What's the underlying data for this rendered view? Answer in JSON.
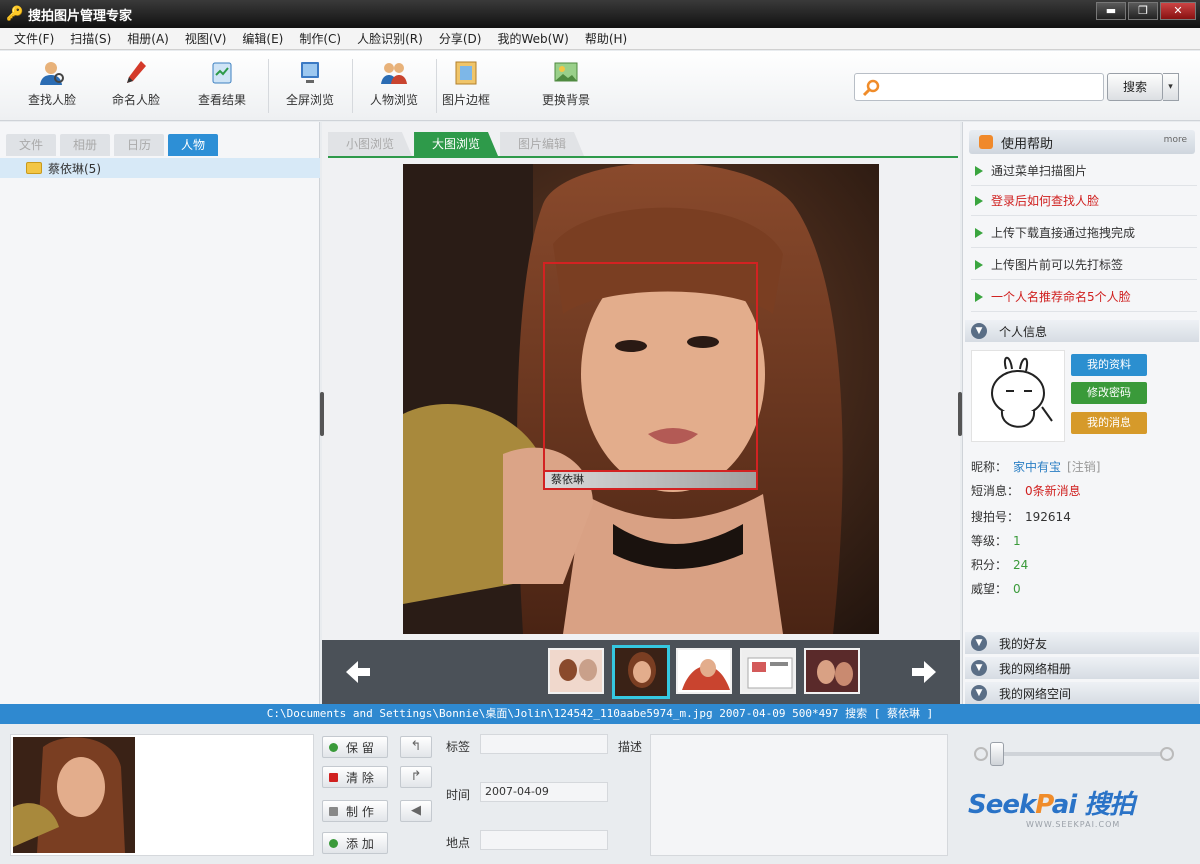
{
  "window": {
    "title": "搜拍图片管理专家",
    "controls": {
      "minimize": "▬",
      "restore": "❐",
      "close": "✕"
    }
  },
  "menu": [
    "文件(F)",
    "扫描(S)",
    "相册(A)",
    "视图(V)",
    "编辑(E)",
    "制作(C)",
    "人脸识别(R)",
    "分享(D)",
    "我的Web(W)",
    "帮助(H)"
  ],
  "toolbar": {
    "find_face": "查找人脸",
    "name_face": "命名人脸",
    "view_results": "查看结果",
    "fullscreen": "全屏浏览",
    "people_browse": "人物浏览",
    "photo_frame": "图片边框",
    "change_bg": "更换背景"
  },
  "search": {
    "placeholder": "",
    "button": "搜索",
    "dropdown": "▾"
  },
  "left_tabs": [
    "文件",
    "相册",
    "日历",
    "人物"
  ],
  "left_tabs_active": 3,
  "tree": {
    "item": "蔡依琳(5)"
  },
  "center_tabs": [
    "小图浏览",
    "大图浏览",
    "图片编辑"
  ],
  "center_tabs_active": 1,
  "face_tag": "蔡依琳",
  "status_path": "C:\\Documents and Settings\\Bonnie\\桌面\\Jolin\\124542_110aabe5974_m.jpg 2007-04-09 500*497 搜索 [ 蔡依琳 ]",
  "help": {
    "title": "使用帮助",
    "more": "more",
    "items": [
      {
        "text": "通过菜单扫描图片",
        "color": "#333333"
      },
      {
        "text": "登录后如何查找人脸",
        "color": "#d0201f"
      },
      {
        "text": "上传下载直接通过拖拽完成",
        "color": "#333333"
      },
      {
        "text": "上传图片前可以先打标签",
        "color": "#333333"
      },
      {
        "text": "一个人名推荐命名5个人脸",
        "color": "#d0201f"
      }
    ]
  },
  "profile": {
    "section_title": "个人信息",
    "buttons": [
      "我的资料",
      "修改密码",
      "我的消息"
    ],
    "button_colors": [
      "#2b8fd0",
      "#3a9a3a",
      "#d69a2a"
    ],
    "rows": [
      {
        "label": "昵称：",
        "value": "家中有宝",
        "extra": "[注销]",
        "color": "#2b7fc4"
      },
      {
        "label": "短消息：",
        "value": "0条新消息",
        "extra": "",
        "color": "#d0201f"
      },
      {
        "label": "搜拍号：",
        "value": "192614",
        "extra": "",
        "color": "#333333"
      },
      {
        "label": "等级：",
        "value": "1",
        "extra": "",
        "color": "#3a9a3a"
      },
      {
        "label": "积分：",
        "value": "24",
        "extra": "",
        "color": "#3a9a3a"
      },
      {
        "label": "威望：",
        "value": "0",
        "extra": "",
        "color": "#3a9a3a"
      }
    ]
  },
  "sections": [
    "我的好友",
    "我的网络相册",
    "我的网络空间"
  ],
  "actions": {
    "keep": "保 留",
    "clear": "清 除",
    "make": "制 作",
    "add": "添 加"
  },
  "fields": {
    "tag_label": "标签",
    "desc_label": "描述",
    "time_label": "时间",
    "time_value": "2007-04-09",
    "place_label": "地点"
  },
  "logo": {
    "text_a": "Seek",
    "text_q": "P",
    "text_b": "ai 搜拍",
    "url": "WWW.SEEKPAI.COM"
  },
  "colors": {
    "accent_blue": "#2f89d0",
    "accent_green": "#2e9a4a",
    "face_red": "#d32222"
  }
}
